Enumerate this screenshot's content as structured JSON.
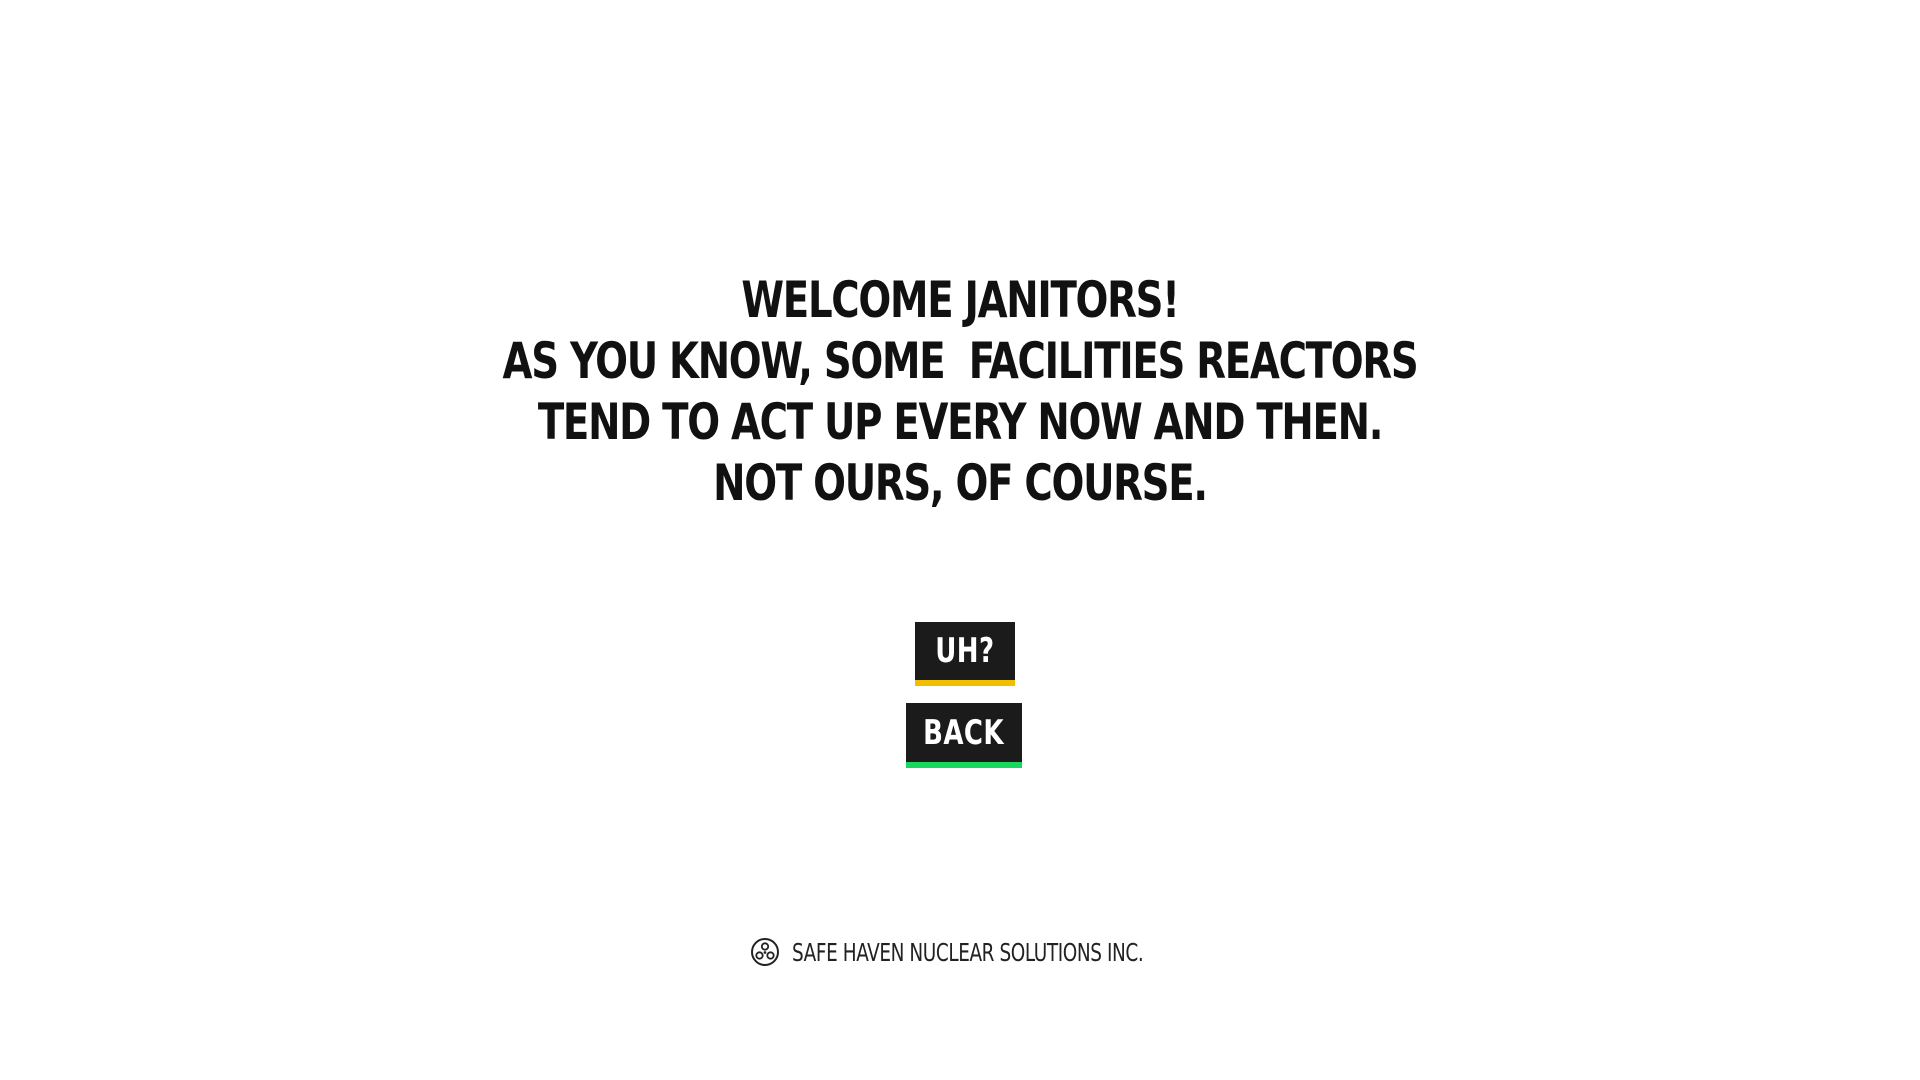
{
  "intro": {
    "lines": [
      "WELCOME JANITORS!",
      "AS YOU KNOW, SOME  FACILITIES REACTORS",
      "TEND TO ACT UP EVERY NOW AND THEN.",
      "NOT OURS, OF COURSE."
    ]
  },
  "buttons": {
    "uh_label": "UH?",
    "uh_accent": "#f0c000",
    "back_label": "BACK",
    "back_accent": "#19d65f"
  },
  "footer": {
    "logo_icon": "radiation-logo-icon",
    "company": "SAFE HAVEN NUCLEAR SOLUTIONS INC."
  }
}
